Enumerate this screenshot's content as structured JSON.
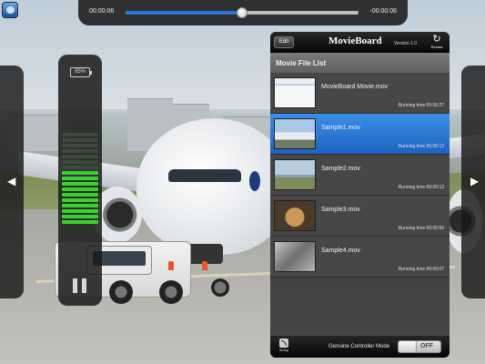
{
  "player": {
    "elapsed": "00:00:06",
    "remaining": "-00:00:06",
    "progress": 0.5
  },
  "volume": {
    "battery": "95%",
    "level_bars_on": 10,
    "total_bars": 17
  },
  "board": {
    "edit_label": "Edit",
    "title": "MovieBoard",
    "version": "Version 1.0",
    "reload_label": "Reload",
    "list_title": "Movie File List",
    "files": [
      {
        "name": "MovieBoard Movie.mov",
        "running_time": "Running time 00:00:27",
        "selected": false
      },
      {
        "name": "Sample1.mov",
        "running_time": "Running time 00:00:12",
        "selected": true
      },
      {
        "name": "Sample2.mov",
        "running_time": "Running time 00:00:12",
        "selected": false
      },
      {
        "name": "Sample3.mov",
        "running_time": "Running time 00:00:56",
        "selected": false
      },
      {
        "name": "Sample4.mov",
        "running_time": "Running time 00:00:07",
        "selected": false
      }
    ],
    "setup_label": "Setup",
    "mode_label": "Genuine Controller Mode",
    "toggle_state": "OFF"
  },
  "icons": {
    "prev": "previous-arrow-icon",
    "next": "next-arrow-icon",
    "reload": "reload-icon",
    "setup": "rss-icon",
    "pause": "pause-icon"
  },
  "colors": {
    "selected_row": "#2a78d6",
    "level_on": "#3bd02f"
  }
}
